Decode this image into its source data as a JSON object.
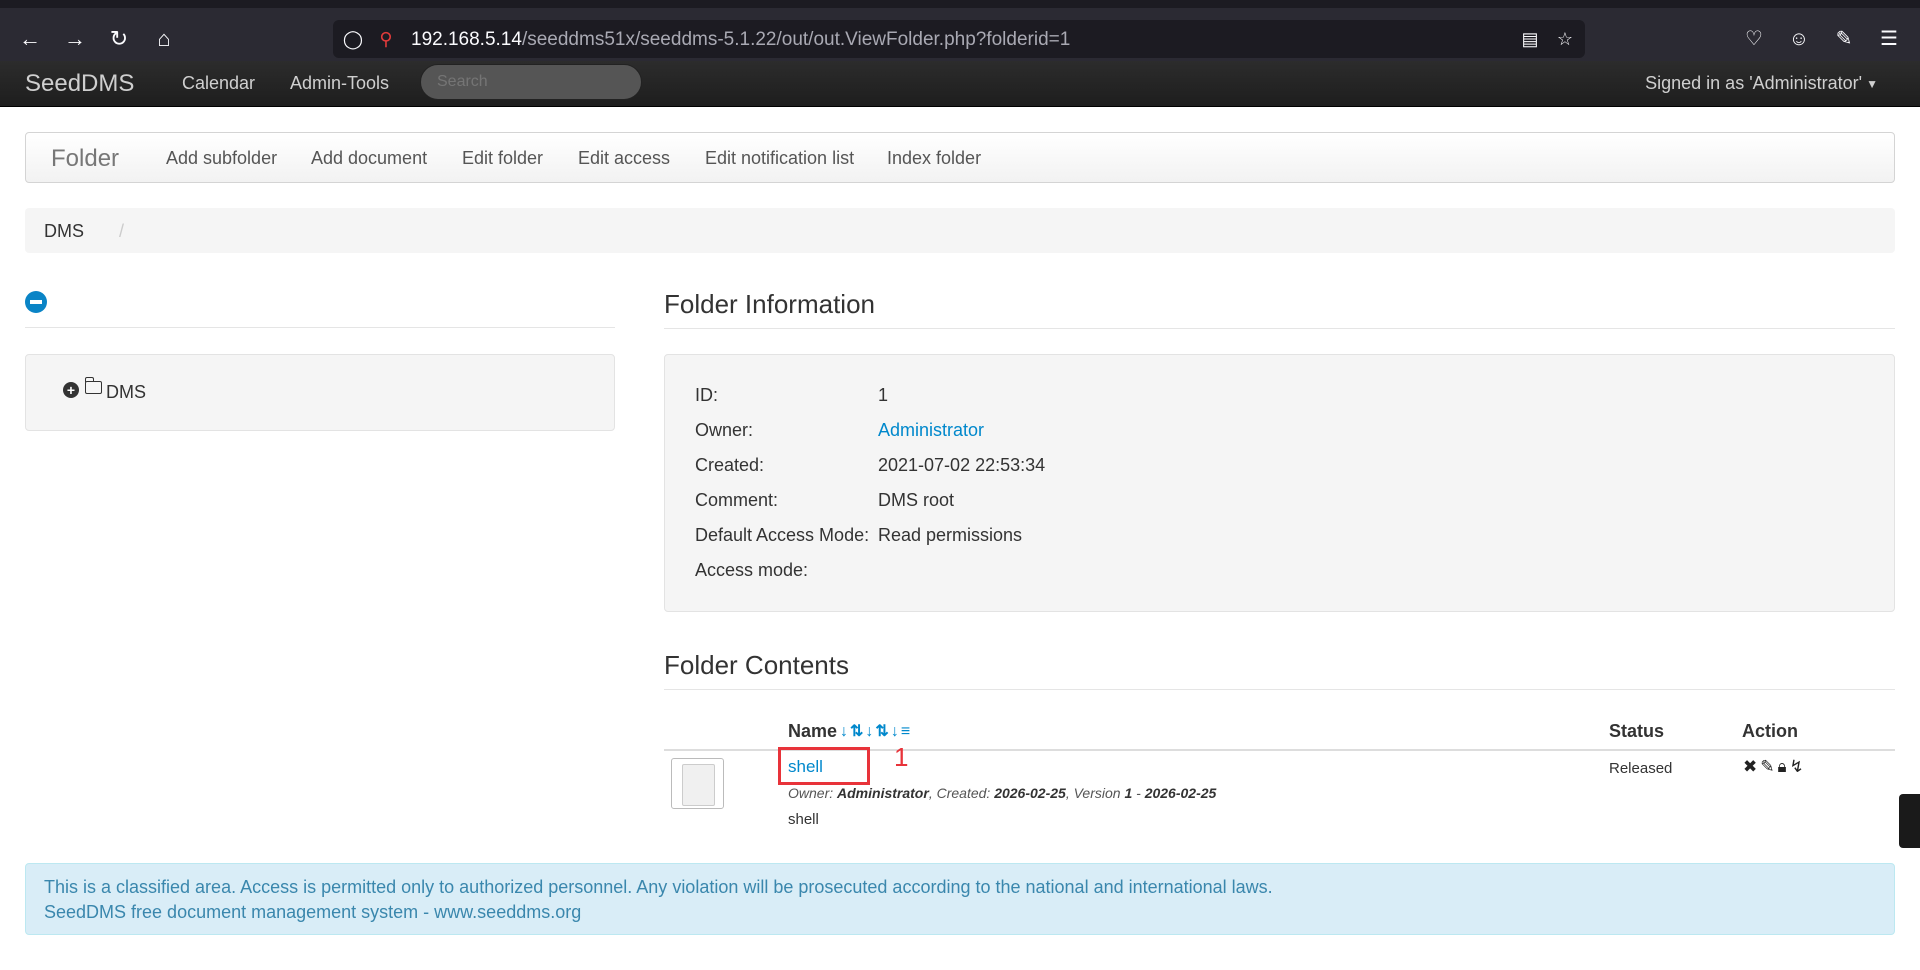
{
  "browser": {
    "url_host": "192.168.5.14",
    "url_path": "/seeddms51x/seeddms-5.1.22/out/out.ViewFolder.php?folderid=1"
  },
  "navbar": {
    "brand": "SeedDMS",
    "links": [
      "Calendar",
      "Admin-Tools"
    ],
    "search_placeholder": "Search",
    "signed_in": "Signed in as 'Administrator'"
  },
  "subnav": {
    "title": "Folder",
    "links": [
      "Add subfolder",
      "Add document",
      "Edit folder",
      "Edit access",
      "Edit notification list",
      "Index folder"
    ]
  },
  "breadcrumb": {
    "root": "DMS",
    "separator": "/"
  },
  "tree": {
    "root_label": "DMS"
  },
  "folder_info": {
    "title": "Folder Information",
    "rows": [
      {
        "label": "ID:",
        "value": "1"
      },
      {
        "label": "Owner:",
        "value": "Administrator"
      },
      {
        "label": "Created:",
        "value": "2021-07-02 22:53:34"
      },
      {
        "label": "Comment:",
        "value": "DMS root"
      },
      {
        "label": "Default Access Mode:",
        "value": "Read permissions"
      },
      {
        "label": "Access mode:",
        "value": ""
      }
    ]
  },
  "folder_contents": {
    "title": "Folder Contents",
    "headers": {
      "name": "Name",
      "status": "Status",
      "action": "Action"
    },
    "documents": [
      {
        "name": "shell",
        "owner_label": "Owner:",
        "owner": "Administrator",
        "created_label": "Created:",
        "created": "2026-02-25",
        "version_label": "Version",
        "version": "1",
        "version_date": "2026-02-25",
        "comment": "shell",
        "status": "Released"
      }
    ],
    "annotation_number": "1"
  },
  "footer": {
    "line1": "This is a classified area. Access is permitted only to authorized personnel. Any violation will be prosecuted according to the national and international laws.",
    "line2": "SeedDMS free document management system - www.seeddms.org"
  },
  "colors": {
    "link": "#0088cc",
    "annotation": "#e8333a",
    "alert_bg": "#d9edf7",
    "alert_text": "#3a87ad"
  }
}
